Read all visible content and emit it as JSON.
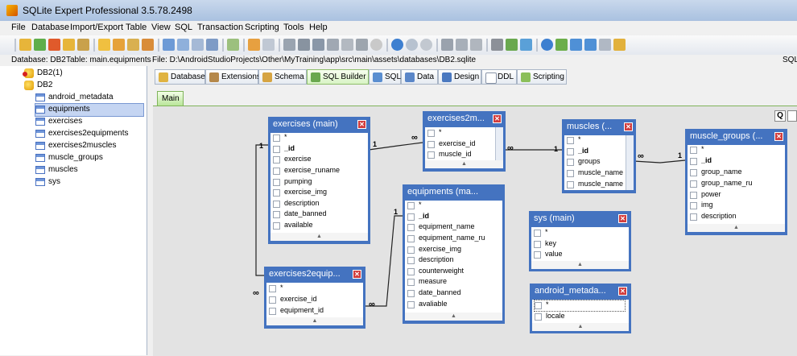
{
  "window": {
    "title": "SQLite Expert Professional 3.5.78.2498"
  },
  "menu": [
    "File",
    "Database",
    "Import/Export",
    "Table",
    "View",
    "SQL",
    "Transaction",
    "Scripting",
    "Tools",
    "Help"
  ],
  "pathbar": {
    "database": "Database: DB2",
    "table": "Table: main.equipments",
    "file": "File: D:\\AndroidStudioProjects\\Other\\MyTraining\\app\\src\\main\\assets\\databases\\DB2.sqlite",
    "right": "SQL"
  },
  "tree": {
    "db1": "DB2(1)",
    "db2": "DB2",
    "tables": [
      "android_metadata",
      "equipments",
      "exercises",
      "exercises2equipments",
      "exercises2muscles",
      "muscle_groups",
      "muscles",
      "sys"
    ],
    "selected": "equipments"
  },
  "tabs": [
    "Database",
    "Extensions",
    "Schema",
    "SQL Builder",
    "SQL",
    "Data",
    "Design",
    "DDL",
    "Scripting"
  ],
  "active_tab": "SQL Builder",
  "subtab": "Main",
  "canvas": {
    "query_button": "Q"
  },
  "entities": {
    "exercises": {
      "title": "exercises (main)",
      "fields": [
        "*",
        "_id",
        "exercise",
        "exercise_runame",
        "pumping",
        "exercise_img",
        "description",
        "date_banned",
        "available"
      ]
    },
    "exercises2muscles": {
      "title": "exercises2m...",
      "fields": [
        "*",
        "exercise_id",
        "muscle_id"
      ]
    },
    "muscles": {
      "title": "muscles (...",
      "fields": [
        "*",
        "_id",
        "groups",
        "muscle_name",
        "muscle_name"
      ]
    },
    "muscle_groups": {
      "title": "muscle_groups (...",
      "fields": [
        "*",
        "_id",
        "group_name",
        "group_name_ru",
        "power",
        "img",
        "description"
      ]
    },
    "equipments": {
      "title": "equipments (ma...",
      "fields": [
        "*",
        "_id",
        "equipment_name",
        "equipment_name_ru",
        "exercise_img",
        "description",
        "counterweight",
        "measure",
        "date_banned",
        "avaliable"
      ]
    },
    "exercises2equipments": {
      "title": "exercises2equip...",
      "fields": [
        "*",
        "exercise_id",
        "equipment_id"
      ]
    },
    "sys": {
      "title": "sys (main)",
      "fields": [
        "*",
        "key",
        "value"
      ]
    },
    "android_metadata": {
      "title": "android_metada...",
      "fields": [
        "*",
        "locale"
      ]
    }
  },
  "relations": {
    "one": "1",
    "many": "∞"
  },
  "colors": {
    "entity": "#4473c0",
    "accent_tab": "#8fbf6c",
    "selection": "#c5d5f2"
  }
}
